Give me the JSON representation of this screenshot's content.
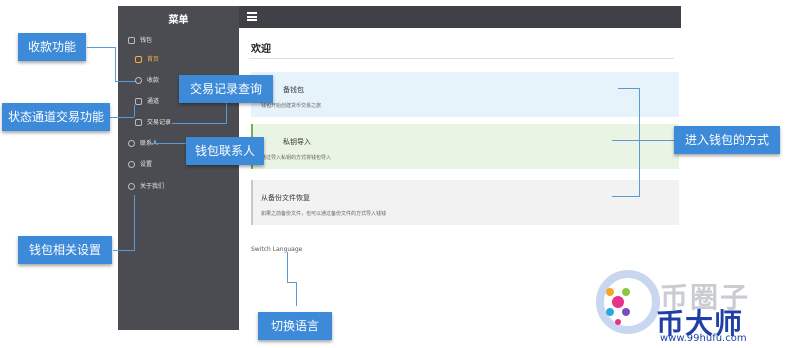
{
  "sidebar": {
    "title": "菜单",
    "items": [
      {
        "label": "钱包",
        "sub": false
      },
      {
        "label": "首页",
        "sub": true,
        "active": true
      },
      {
        "label": "收款",
        "sub": true
      },
      {
        "label": "通道",
        "sub": true
      },
      {
        "label": "交易记录",
        "sub": true
      },
      {
        "label": "联系人",
        "sub": false
      },
      {
        "label": "设置",
        "sub": false
      },
      {
        "label": "关于我们",
        "sub": false
      }
    ]
  },
  "main": {
    "title": "欢迎",
    "cards": [
      {
        "title": "备钱包",
        "desc": "钱包开始创建货币交易之旅"
      },
      {
        "title": "私钥导入",
        "desc": "通过导入私钥的方式将钱包导入"
      },
      {
        "title": "从备份文件恢复",
        "desc": "如果之前备份文件，也可以通过备份文件的方式导入钱钱"
      }
    ],
    "switch_language": "Switch Language"
  },
  "callouts": {
    "receive": "收款功能",
    "records": "交易记录查询",
    "channel": "状态通道交易功能",
    "contacts": "钱包联系人",
    "enter": "进入钱包的方式",
    "settings": "钱包相关设置",
    "language": "切换语言"
  },
  "watermark": {
    "title": "币圈子",
    "brand": "币大师",
    "url": "www.99hufu.com"
  },
  "colors": {
    "sidebar": "#4a4c52",
    "topbar": "#3f4146",
    "callout": "#3d8ad9",
    "active": "#f0b43c"
  }
}
